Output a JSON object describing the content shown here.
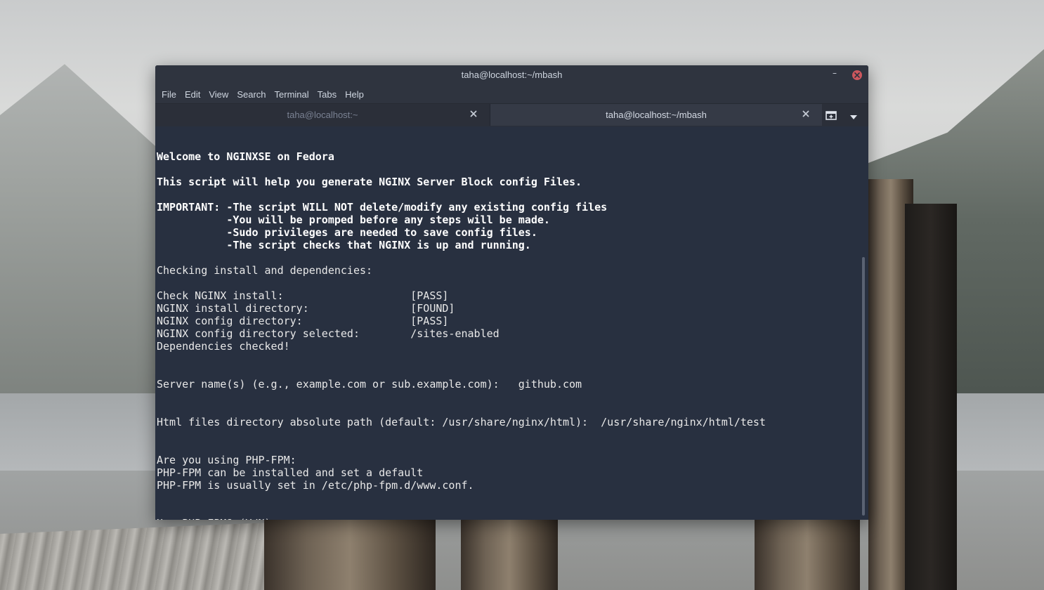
{
  "window": {
    "title": "taha@localhost:~/mbash",
    "minimize_icon": "minimize-icon",
    "close_icon": "close-icon",
    "close_color": "#cc575d"
  },
  "menubar": {
    "items": [
      {
        "label": "File"
      },
      {
        "label": "Edit"
      },
      {
        "label": "View"
      },
      {
        "label": "Search"
      },
      {
        "label": "Terminal"
      },
      {
        "label": "Tabs"
      },
      {
        "label": "Help"
      }
    ]
  },
  "tabs": [
    {
      "label": "taha@localhost:~",
      "active": false
    },
    {
      "label": "taha@localhost:~/mbash",
      "active": true
    }
  ],
  "tabbar_icons": {
    "new_tab": "new-tab-icon",
    "menu": "chevron-down-icon"
  },
  "terminal": {
    "background": "#283040",
    "lines": [
      {
        "text": "",
        "bold": false
      },
      {
        "text": "Welcome to NGINXSE on Fedora",
        "bold": true
      },
      {
        "text": "",
        "bold": false
      },
      {
        "text": "This script will help you generate NGINX Server Block config Files.",
        "bold": true
      },
      {
        "text": "",
        "bold": false
      },
      {
        "text": "IMPORTANT: -The script WILL NOT delete/modify any existing config files",
        "bold": true
      },
      {
        "text": "           -You will be promped before any steps will be made.",
        "bold": true
      },
      {
        "text": "           -Sudo privileges are needed to save config files.",
        "bold": true
      },
      {
        "text": "           -The script checks that NGINX is up and running.",
        "bold": true
      },
      {
        "text": "",
        "bold": false
      },
      {
        "text": "Checking install and dependencies:",
        "bold": false
      },
      {
        "text": "",
        "bold": false
      },
      {
        "text": "Check NGINX install:                    [PASS]",
        "bold": false
      },
      {
        "text": "NGINX install directory:                [FOUND]",
        "bold": false
      },
      {
        "text": "NGINX config directory:                 [PASS]",
        "bold": false
      },
      {
        "text": "NGINX config directory selected:        /sites-enabled",
        "bold": false
      },
      {
        "text": "Dependencies checked!",
        "bold": false
      },
      {
        "text": "",
        "bold": false
      },
      {
        "text": "",
        "bold": false
      },
      {
        "text": "Server name(s) (e.g., example.com or sub.example.com):   github.com",
        "bold": false
      },
      {
        "text": "",
        "bold": false
      },
      {
        "text": "",
        "bold": false
      },
      {
        "text": "Html files directory absolute path (default: /usr/share/nginx/html):  /usr/share/nginx/html/test",
        "bold": false
      },
      {
        "text": "",
        "bold": false
      },
      {
        "text": "",
        "bold": false
      },
      {
        "text": "Are you using PHP-FPM:",
        "bold": false
      },
      {
        "text": "PHP-FPM can be installed and set a default",
        "bold": false
      },
      {
        "text": "PHP-FPM is usually set in /etc/php-fpm.d/www.conf.",
        "bold": false
      },
      {
        "text": "",
        "bold": false
      },
      {
        "text": "",
        "bold": false
      }
    ],
    "prompt": "Use PHP-FPM? (Y/N):  "
  }
}
